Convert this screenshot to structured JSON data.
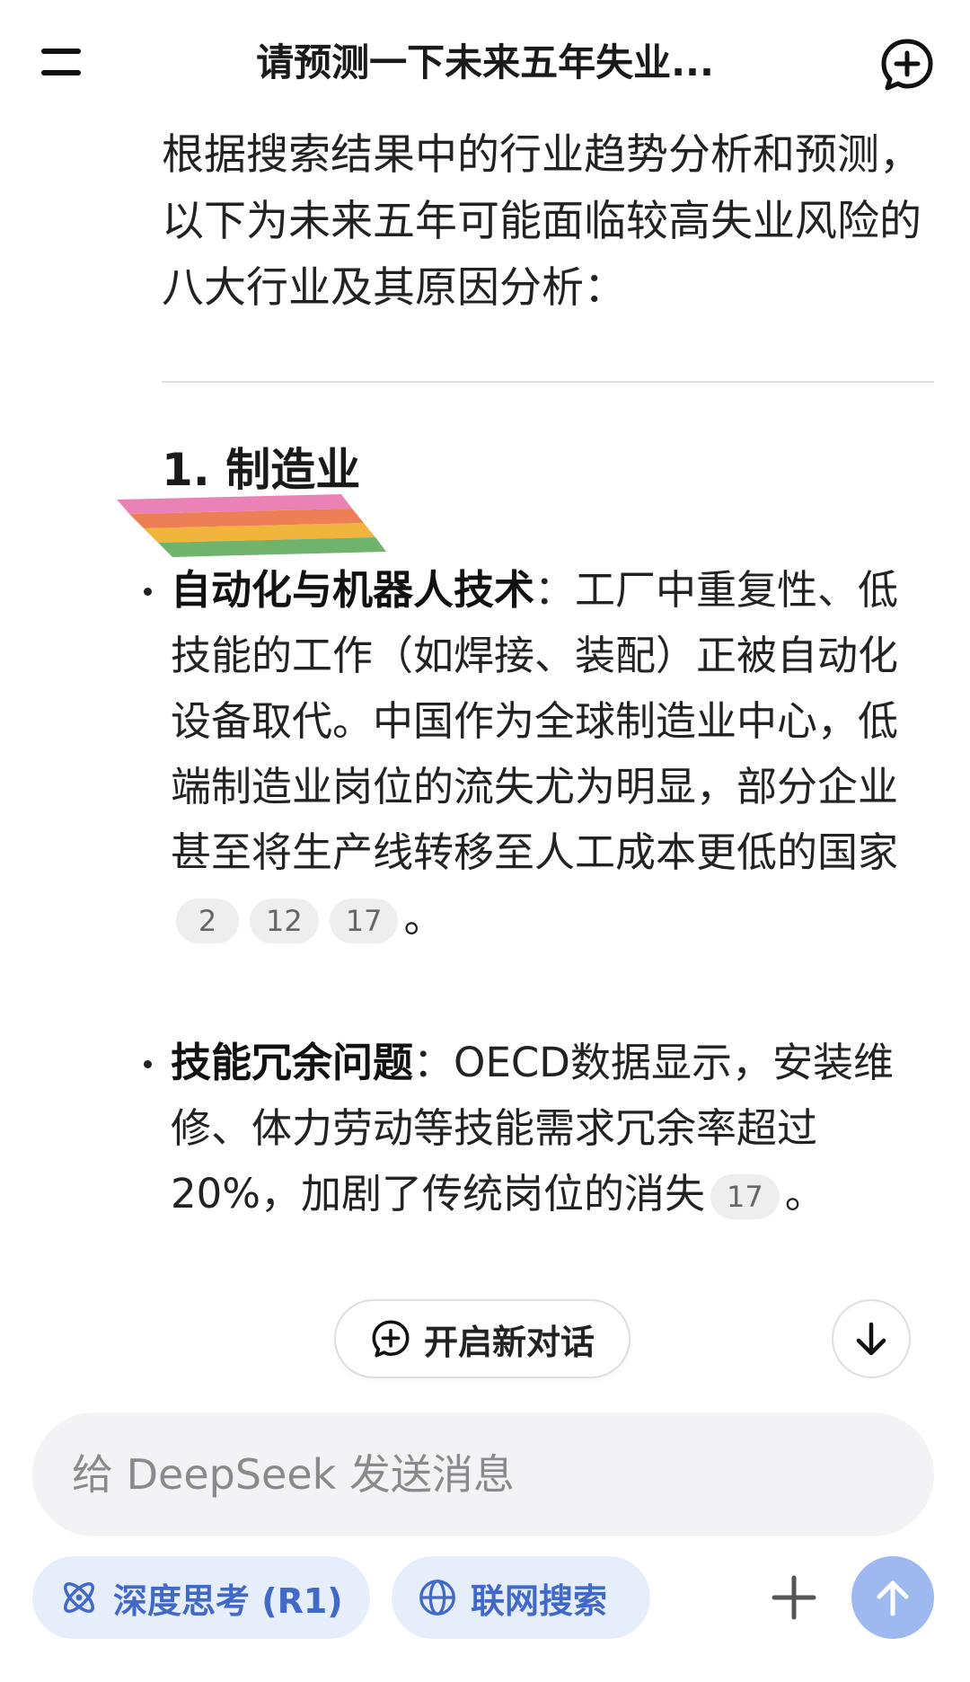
{
  "header": {
    "title": "请预测一下未来五年失业..."
  },
  "message": {
    "intro": "根据搜索结果中的行业趋势分析和预测，以下为未来五年可能面临较高失业风险的八大行业及其原因分析：",
    "section_heading": "1. 制造业",
    "bullets": [
      {
        "term": "自动化与机器人技术",
        "separator": "：",
        "text": "工厂中重复性、低技能的工作（如焊接、装配）正被自动化设备取代。中国作为全球制造业中心，低端制造业岗位的流失尤为明显，部分企业甚至将生产线转移至人工成本更低的国家",
        "citations": [
          "2",
          "12",
          "17"
        ],
        "end": "。"
      },
      {
        "term": "技能冗余问题",
        "separator": "：",
        "text": "OECD数据显示，安装维修、体力劳动等技能需求冗余率超过20%，加剧了传统岗位的消失",
        "citations": [
          "17"
        ],
        "end": "。"
      }
    ]
  },
  "actions": {
    "new_dialog_label": "开启新对话"
  },
  "composer": {
    "placeholder": "给 DeepSeek 发送消息",
    "value": ""
  },
  "toolbar": {
    "deep_think_label": "深度思考 (R1)",
    "web_search_label": "联网搜索"
  },
  "icons": {
    "menu": "menu-icon",
    "new_chat": "new-chat-icon",
    "scroll_down": "arrow-down-icon",
    "deep_think": "atom-icon",
    "web_search": "globe-icon",
    "attach": "plus-icon",
    "send": "arrow-up-icon"
  },
  "colors": {
    "accent": "#4169c8",
    "pill_bg": "#e7eefb",
    "send_bg": "#9db9ef",
    "citation_bg": "#eeeeee"
  }
}
